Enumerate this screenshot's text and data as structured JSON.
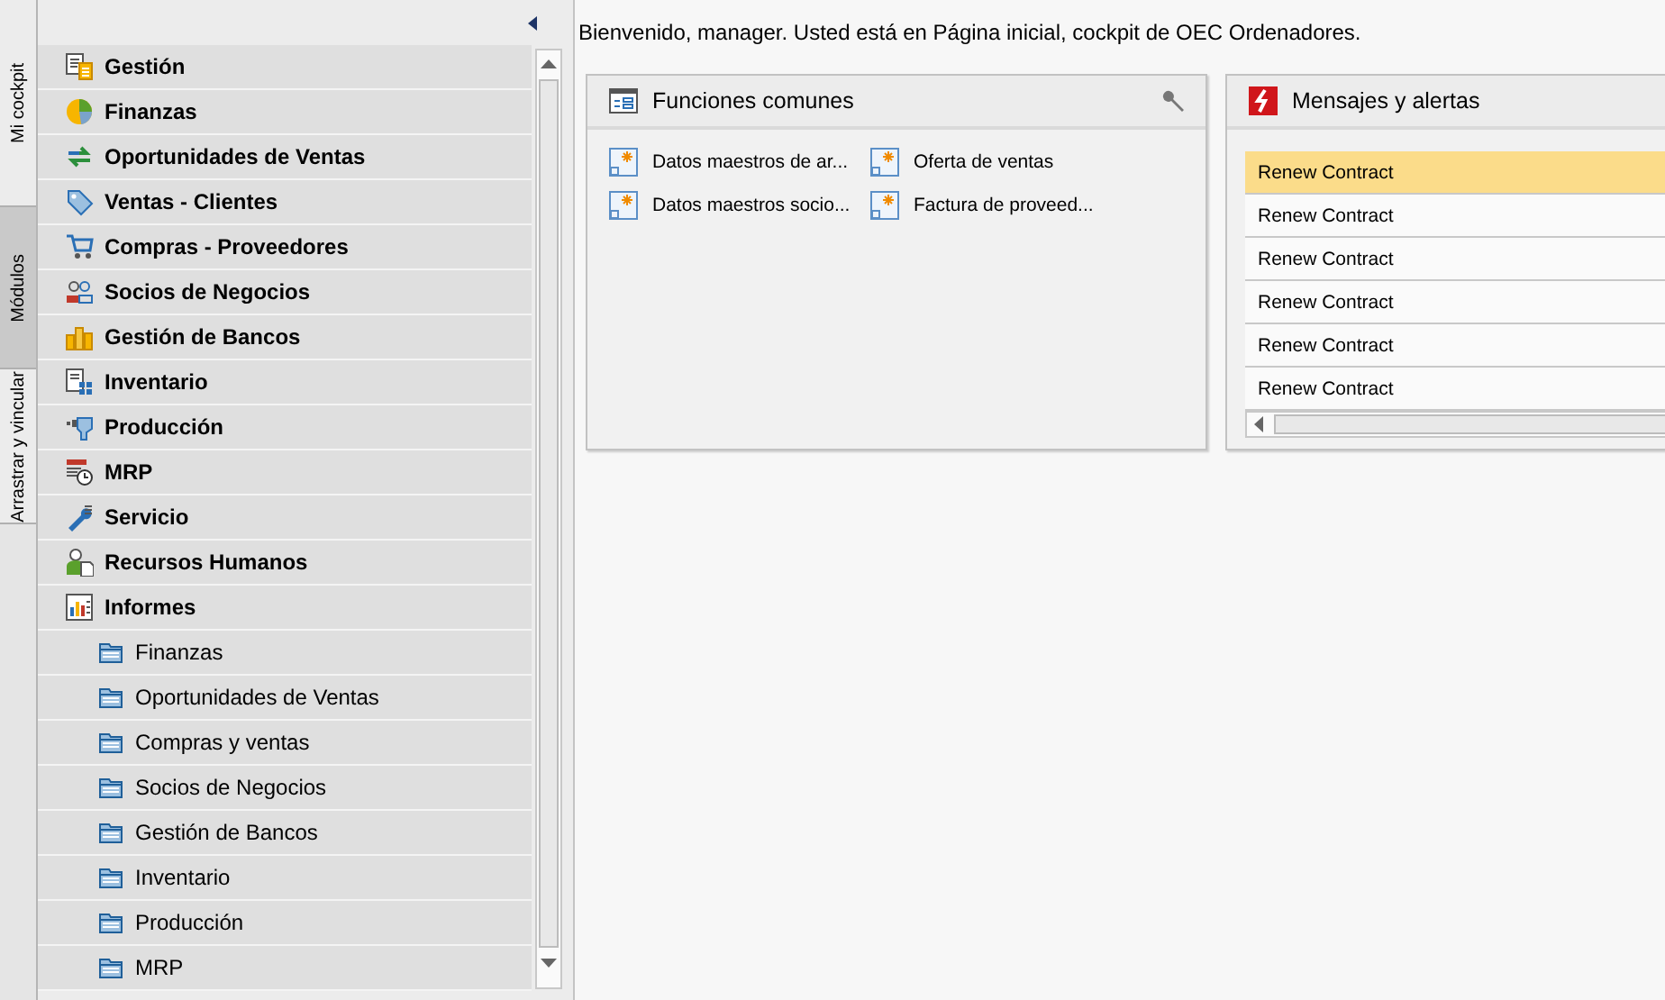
{
  "vertical_tabs": [
    {
      "label": "Mi cockpit",
      "selected": false
    },
    {
      "label": "Módulos",
      "selected": true
    },
    {
      "label": "Arrastrar y vincular",
      "selected": false
    }
  ],
  "modules": [
    {
      "label": "Gestión"
    },
    {
      "label": "Finanzas"
    },
    {
      "label": "Oportunidades de Ventas"
    },
    {
      "label": "Ventas - Clientes"
    },
    {
      "label": "Compras - Proveedores"
    },
    {
      "label": "Socios de Negocios"
    },
    {
      "label": "Gestión de Bancos"
    },
    {
      "label": "Inventario"
    },
    {
      "label": "Producción"
    },
    {
      "label": "MRP"
    },
    {
      "label": "Servicio"
    },
    {
      "label": "Recursos Humanos"
    },
    {
      "label": "Informes",
      "children": [
        {
          "label": "Finanzas"
        },
        {
          "label": "Oportunidades de Ventas"
        },
        {
          "label": "Compras y ventas"
        },
        {
          "label": "Socios de Negocios"
        },
        {
          "label": "Gestión de Bancos"
        },
        {
          "label": "Inventario"
        },
        {
          "label": "Producción"
        },
        {
          "label": "MRP"
        }
      ]
    }
  ],
  "welcome": "Bienvenido, manager. Usted está en Página inicial, cockpit de OEC Ordenadores.",
  "common_functions": {
    "title": "Funciones comunes",
    "items": [
      "Datos maestros de ar...",
      "Oferta de ventas",
      "Datos maestros socio...",
      "Factura de proveed..."
    ]
  },
  "alerts": {
    "title": "Mensajes y alertas",
    "rows": [
      {
        "label": "Renew Contract",
        "selected": true
      },
      {
        "label": "Renew Contract",
        "selected": false
      },
      {
        "label": "Renew Contract",
        "selected": false
      },
      {
        "label": "Renew Contract",
        "selected": false
      },
      {
        "label": "Renew Contract",
        "selected": false
      },
      {
        "label": "Renew Contract",
        "selected": false
      }
    ]
  }
}
